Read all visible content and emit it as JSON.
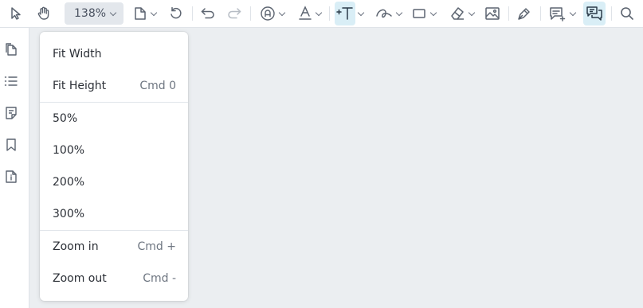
{
  "toolbar": {
    "zoom_value": "138%",
    "tools": [
      {
        "name": "select-tool",
        "icon": "cursor-arrow-icon"
      },
      {
        "name": "pan-tool",
        "icon": "hand-icon"
      },
      {
        "name": "page-menu",
        "icon": "document-icon"
      },
      {
        "name": "rotate",
        "icon": "rotate-icon"
      },
      {
        "name": "undo",
        "icon": "undo-icon"
      },
      {
        "name": "redo",
        "icon": "redo-icon"
      },
      {
        "name": "stamp-tool",
        "icon": "stamp-icon"
      },
      {
        "name": "text-color-tool",
        "icon": "text-color-icon"
      },
      {
        "name": "add-text-tool",
        "icon": "add-text-icon",
        "active": true
      },
      {
        "name": "ink-tool",
        "icon": "ink-icon"
      },
      {
        "name": "shape-tool",
        "icon": "rectangle-icon"
      },
      {
        "name": "eraser-tool",
        "icon": "eraser-icon"
      },
      {
        "name": "image-tool",
        "icon": "image-icon"
      },
      {
        "name": "signature-tool",
        "icon": "pen-icon"
      },
      {
        "name": "comment-tool",
        "icon": "comment-add-icon"
      },
      {
        "name": "comments-panel",
        "icon": "comments-icon",
        "active": true
      },
      {
        "name": "search",
        "icon": "search-icon"
      }
    ]
  },
  "sidebar": {
    "items": [
      {
        "name": "thumbnails",
        "icon": "pages-icon"
      },
      {
        "name": "outline",
        "icon": "list-icon"
      },
      {
        "name": "annotations",
        "icon": "notes-icon"
      },
      {
        "name": "bookmarks",
        "icon": "bookmark-icon"
      },
      {
        "name": "document-info",
        "icon": "info-document-icon"
      }
    ]
  },
  "zoom_menu": {
    "items": [
      {
        "label": "Fit Width",
        "shortcut": ""
      },
      {
        "label": "Fit Height",
        "shortcut": "Cmd 0"
      },
      {
        "label": "50%",
        "shortcut": ""
      },
      {
        "label": "100%",
        "shortcut": ""
      },
      {
        "label": "200%",
        "shortcut": ""
      },
      {
        "label": "300%",
        "shortcut": ""
      },
      {
        "label": "Zoom in",
        "shortcut": "Cmd +"
      },
      {
        "label": "Zoom out",
        "shortcut": "Cmd -"
      }
    ]
  },
  "colors": {
    "accent_active": "#d9eef6",
    "canvas_bg": "#ebeef1",
    "icon": "#5c6470"
  }
}
